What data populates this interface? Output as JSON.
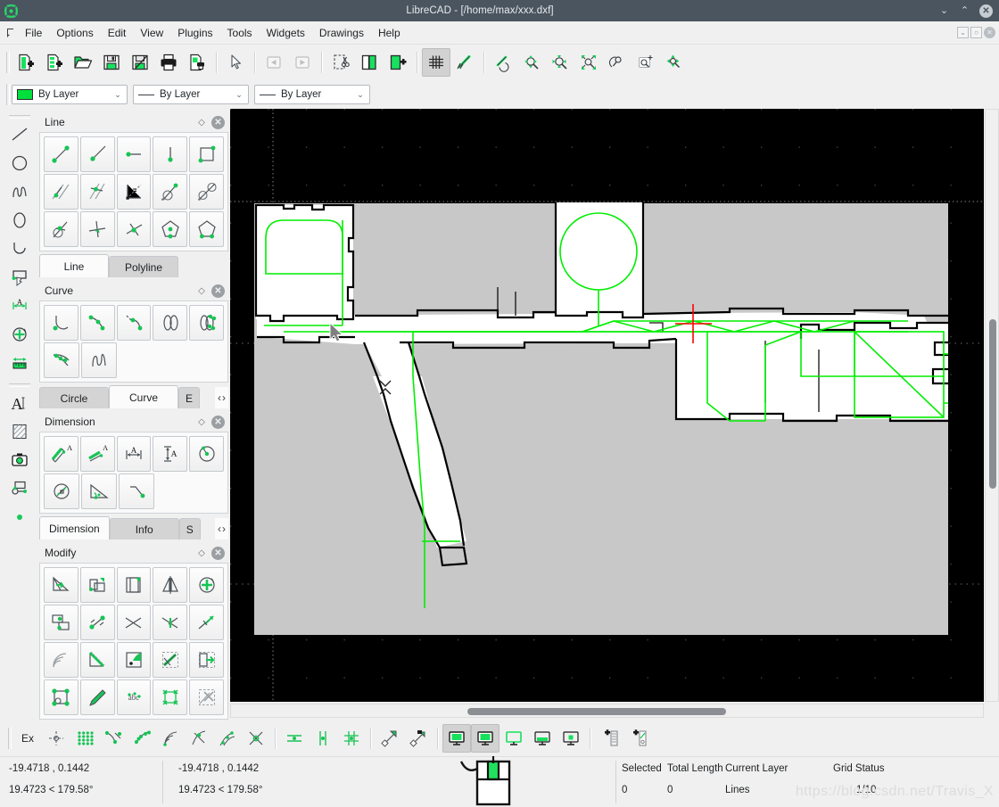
{
  "window": {
    "app_icon": "librecad-logo-icon",
    "title": "LibreCAD - [/home/max/xxx.dxf]",
    "minimize_label": "⌄",
    "maximize_label": "⌃",
    "close_label": "✕",
    "mdi_minimize_label": "⌄",
    "mdi_restore_label": "○",
    "mdi_close_label": "✕"
  },
  "menubar": {
    "items": [
      {
        "label": "File"
      },
      {
        "label": "Options"
      },
      {
        "label": "Edit"
      },
      {
        "label": "View"
      },
      {
        "label": "Plugins"
      },
      {
        "label": "Tools"
      },
      {
        "label": "Widgets"
      },
      {
        "label": "Drawings"
      },
      {
        "label": "Help"
      }
    ]
  },
  "main_toolbar": {
    "groups": [
      {
        "buttons": [
          {
            "icon": "new-file-icon"
          },
          {
            "icon": "new-from-template-icon"
          },
          {
            "icon": "open-file-icon"
          },
          {
            "icon": "save-icon"
          },
          {
            "icon": "save-as-icon"
          },
          {
            "icon": "print-icon"
          },
          {
            "icon": "print-preview-icon"
          }
        ]
      },
      {
        "buttons": [
          {
            "icon": "select-pointer-icon"
          }
        ]
      },
      {
        "buttons": [
          {
            "icon": "undo-icon",
            "disabled": true
          },
          {
            "icon": "redo-icon",
            "disabled": true
          }
        ]
      },
      {
        "buttons": [
          {
            "icon": "cut-icon"
          },
          {
            "icon": "copy-icon"
          },
          {
            "icon": "paste-icon"
          }
        ]
      },
      {
        "buttons": [
          {
            "icon": "grid-toggle-icon",
            "active": true
          },
          {
            "icon": "draft-mode-icon"
          }
        ]
      },
      {
        "buttons": [
          {
            "icon": "zoom-previous-icon"
          },
          {
            "icon": "zoom-in-icon"
          },
          {
            "icon": "zoom-out-icon"
          },
          {
            "icon": "zoom-auto-icon"
          },
          {
            "icon": "zoom-redraw-icon"
          },
          {
            "icon": "zoom-window-icon"
          },
          {
            "icon": "zoom-pan-icon"
          }
        ]
      }
    ]
  },
  "attribute_bar": {
    "layer_color": {
      "value": "By Layer",
      "swatch": "#00e03c",
      "kind": "color"
    },
    "layer_width": {
      "value": "By Layer",
      "kind": "width"
    },
    "layer_linetype": {
      "value": "By Layer",
      "kind": "linetype"
    },
    "dropdown_arrow": "⌄"
  },
  "left_toolbar": {
    "buttons": [
      {
        "icon": "line-tool-icon"
      },
      {
        "icon": "circle-tool-icon"
      },
      {
        "icon": "spline-tool-icon"
      },
      {
        "icon": "ellipse-tool-icon"
      },
      {
        "icon": "arc-tool-icon"
      },
      {
        "icon": "polyline-tool-icon"
      },
      {
        "icon": "dimension-tool-icon"
      },
      {
        "icon": "modify-move-rotate-icon"
      },
      {
        "icon": "measure-tool-icon"
      },
      {
        "icon": "text-tool-icon"
      },
      {
        "icon": "hatch-tool-icon"
      },
      {
        "icon": "image-tool-icon"
      },
      {
        "icon": "block-tool-icon"
      },
      {
        "icon": "point-tool-icon"
      }
    ]
  },
  "docks": [
    {
      "id": "line-dock",
      "title": "Line",
      "float_icon": "float-diamond-icon",
      "close_icon": "close-icon",
      "rows": [
        [
          {
            "icon": "line-2points-icon"
          },
          {
            "icon": "line-angle-icon"
          },
          {
            "icon": "line-horizontal-icon"
          },
          {
            "icon": "line-vertical-icon"
          },
          {
            "icon": "line-rectangle-icon"
          }
        ],
        [
          {
            "icon": "line-parallel-icon"
          },
          {
            "icon": "line-parallel-through-icon"
          },
          {
            "icon": "line-bisector-icon"
          },
          {
            "icon": "line-tangent-point-icon"
          },
          {
            "icon": "line-tangent-2circles-icon"
          }
        ],
        [
          {
            "icon": "line-orthogonal-tangent-icon"
          },
          {
            "icon": "line-orthogonal-icon"
          },
          {
            "icon": "line-relative-angle-icon"
          },
          {
            "icon": "line-polygon-center-icon"
          },
          {
            "icon": "line-polygon-corners-icon"
          }
        ]
      ],
      "tabs": [
        {
          "label": "Line",
          "selected": true
        },
        {
          "label": "Polyline",
          "selected": false
        }
      ],
      "has_tab_nav": false
    },
    {
      "id": "curve-dock",
      "title": "Curve",
      "float_icon": "float-diamond-icon",
      "close_icon": "close-icon",
      "rows": [
        [
          {
            "icon": "arc-center-points-icon"
          },
          {
            "icon": "arc-3points-icon"
          },
          {
            "icon": "arc-tangential-icon"
          },
          {
            "icon": "ellipse-arc-axis-icon"
          },
          {
            "icon": "ellipse-foci-point-icon"
          }
        ],
        [
          {
            "icon": "ellipse-inscribed-icon"
          },
          {
            "icon": "spline-points-icon"
          }
        ]
      ],
      "tabs": [
        {
          "label": "Circle",
          "selected": false
        },
        {
          "label": "Curve",
          "selected": true
        },
        {
          "label": "E",
          "selected": false
        }
      ],
      "has_tab_nav": true,
      "nav_prev": "‹",
      "nav_next": "›"
    },
    {
      "id": "dimension-dock",
      "title": "Dimension",
      "float_icon": "float-diamond-icon",
      "close_icon": "close-icon",
      "rows": [
        [
          {
            "icon": "dim-aligned-icon"
          },
          {
            "icon": "dim-linear-icon"
          },
          {
            "icon": "dim-horizontal-icon"
          },
          {
            "icon": "dim-vertical-icon"
          },
          {
            "icon": "dim-radial-icon"
          }
        ],
        [
          {
            "icon": "dim-diametric-icon"
          },
          {
            "icon": "dim-angular-icon"
          },
          {
            "icon": "dim-leader-icon"
          }
        ]
      ],
      "tabs": [
        {
          "label": "Dimension",
          "selected": true
        },
        {
          "label": "Info",
          "selected": false
        },
        {
          "label": "S",
          "selected": false
        }
      ],
      "has_tab_nav": true,
      "nav_prev": "‹",
      "nav_next": "›"
    },
    {
      "id": "modify-dock",
      "title": "Modify",
      "float_icon": "float-diamond-icon",
      "close_icon": "close-icon",
      "rows": [
        [
          {
            "icon": "modify-trim-icon"
          },
          {
            "icon": "modify-scale-icon"
          },
          {
            "icon": "modify-offset-icon"
          },
          {
            "icon": "modify-mirror-icon"
          },
          {
            "icon": "modify-rotate-icon"
          }
        ],
        [
          {
            "icon": "modify-move-copy-icon"
          },
          {
            "icon": "modify-stretch-icon"
          },
          {
            "icon": "modify-trim-two-icon"
          },
          {
            "icon": "modify-divide-icon"
          },
          {
            "icon": "modify-lengthen-icon"
          }
        ],
        [
          {
            "icon": "modify-revert-direction-icon"
          },
          {
            "icon": "modify-bevel-icon"
          },
          {
            "icon": "modify-round-icon"
          },
          {
            "icon": "modify-properties-icon"
          },
          {
            "icon": "modify-explode-icon"
          }
        ],
        [
          {
            "icon": "modify-entity-points-icon"
          },
          {
            "icon": "modify-pen-icon"
          },
          {
            "icon": "modify-explode-text-icon"
          },
          {
            "icon": "modify-block-points-icon"
          },
          {
            "icon": "modify-delete-selected-icon"
          }
        ]
      ],
      "tabs": [],
      "has_tab_nav": false
    }
  ],
  "canvas": {
    "background": "#000000",
    "grid_dot_color": "#4d4d4d",
    "axis_color": "#707070",
    "map_fill": "#c8c8c8",
    "room_fill": "#ffffff",
    "wall_color": "#000000",
    "path_color": "#00ee00",
    "marker_color": "#ff0000",
    "cursor_icon": "arrow-cursor-icon",
    "horizontal_scrollbar": {
      "name": "horizontal-scrollbar"
    },
    "vertical_scrollbar": {
      "name": "vertical-scrollbar"
    }
  },
  "bottom_toolbar": {
    "snap_label": "Ex",
    "groups": [
      {
        "buttons": [
          {
            "icon": "snap-free-icon"
          },
          {
            "icon": "snap-grid-icon"
          },
          {
            "icon": "snap-endpoint-icon"
          },
          {
            "icon": "snap-on-entity-icon"
          },
          {
            "icon": "snap-center-icon"
          },
          {
            "icon": "snap-middle-icon"
          },
          {
            "icon": "snap-distance-icon"
          },
          {
            "icon": "snap-intersection-icon"
          }
        ]
      },
      {
        "buttons": [
          {
            "icon": "restrict-horizontal-icon"
          },
          {
            "icon": "restrict-vertical-icon"
          },
          {
            "icon": "restrict-orthogonal-icon"
          }
        ]
      },
      {
        "buttons": [
          {
            "icon": "relative-zero-icon"
          },
          {
            "icon": "lock-relative-zero-icon"
          }
        ]
      },
      {
        "buttons": [
          {
            "icon": "statusbar-toggle-icon",
            "active": true
          },
          {
            "icon": "cmdline-toggle-icon",
            "active": true
          },
          {
            "icon": "layerlist-toggle-icon"
          },
          {
            "icon": "blocklist-toggle-icon"
          },
          {
            "icon": "library-toggle-icon"
          }
        ]
      },
      {
        "buttons": [
          {
            "icon": "add-layer-icon"
          },
          {
            "icon": "add-block-icon"
          }
        ]
      }
    ]
  },
  "statusbar": {
    "absolute_coordinate": "-19.4718 , 0.1442",
    "absolute_polar": "19.4723 < 179.58°",
    "relative_coordinate": "-19.4718 , 0.1442",
    "relative_polar": "19.4723 < 179.58°",
    "mouse_hint_icon": "mouse-widget-icon",
    "fields": [
      {
        "header": "Selected",
        "value": "0"
      },
      {
        "header": "Total Length",
        "value": "0"
      },
      {
        "header": "Current Layer",
        "value": "Lines"
      },
      {
        "header": "Grid Status",
        "value": "1/10"
      }
    ],
    "watermark": "https://blog.csdn.net/Travis_X"
  }
}
